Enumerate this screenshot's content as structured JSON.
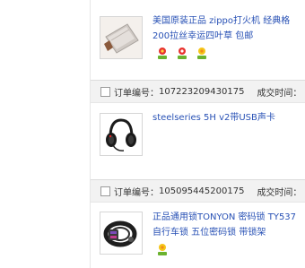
{
  "orders": [
    {
      "title_lines": [
        "美国原装正品 zippo打火机 经典格",
        "200拉丝幸运四叶草 包邮"
      ],
      "badge_icons": [
        "flower-badge-red-icon",
        "flower-badge-red-icon",
        "flower-badge-yellow-icon"
      ]
    },
    {
      "header": {
        "label": "订单编号：",
        "number": "107223209430175",
        "time_label": "成交时间："
      },
      "title_lines": [
        "steelseries 5H v2带USB声卡"
      ],
      "badge_icons": []
    },
    {
      "header": {
        "label": "订单编号：",
        "number": "105095445200175",
        "time_label": "成交时间："
      },
      "title_lines": [
        "正品通用锁TONYON 密码锁 TY537",
        "自行车锁 五位密码锁 带锁架"
      ],
      "badge_icons": [
        "flower-badge-yellow-icon"
      ]
    }
  ],
  "colors": {
    "link": "#2851b5",
    "header_bg": "#f2f2f2"
  }
}
